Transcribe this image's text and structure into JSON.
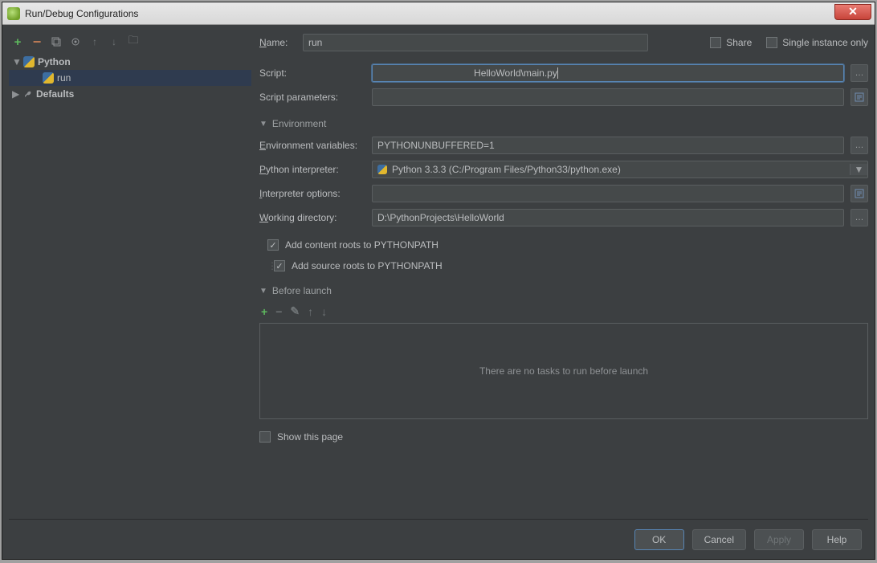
{
  "window": {
    "title": "Run/Debug Configurations"
  },
  "sidebar": {
    "nodes": {
      "python": "Python",
      "run": "run",
      "defaults": "Defaults"
    }
  },
  "form": {
    "name_label": "Name:",
    "name_value": "run",
    "share_label": "Share",
    "single_instance_label": "Single instance only",
    "script_label": "Script:",
    "script_value": "                                    HelloWorld\\main.py",
    "script_params_label": "Script parameters:",
    "script_params_value": "",
    "env_section": "Environment",
    "env_vars_label": "Environment variables:",
    "env_vars_value": "PYTHONUNBUFFERED=1",
    "py_interp_label": "Python interpreter:",
    "py_interp_value": "Python 3.3.3 (C:/Program Files/Python33/python.exe)",
    "interp_opts_label": "Interpreter options:",
    "interp_opts_value": "",
    "working_dir_label": "Working directory:",
    "working_dir_value": "D:\\PythonProjects\\HelloWorld",
    "add_content_roots": "Add content roots to PYTHONPATH",
    "add_source_roots": "Add source roots to PYTHONPATH",
    "before_section": "Before launch",
    "before_empty": "There are no tasks to run before launch",
    "show_page": "Show this page"
  },
  "footer": {
    "ok": "OK",
    "cancel": "Cancel",
    "apply": "Apply",
    "help": "Help"
  }
}
